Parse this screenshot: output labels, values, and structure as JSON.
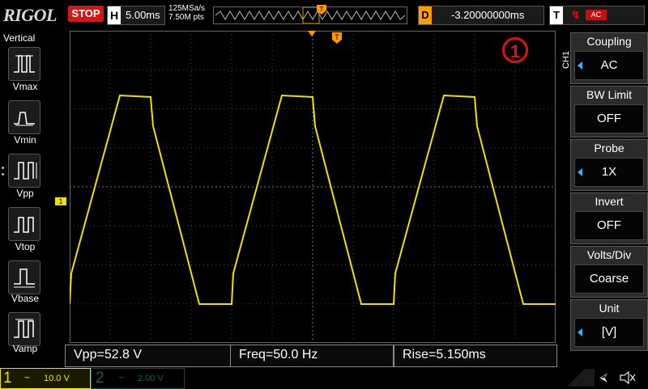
{
  "header": {
    "logo": "RIGOL",
    "run_state": "STOP",
    "horizontal_label": "H",
    "timebase": "5.00ms",
    "sample_rate": "125MSa/s",
    "memory_depth": "7.50M pts",
    "delay_label": "D",
    "delay_value": "-3.20000000ms",
    "trigger_label": "T",
    "trigger_slope_icon": "rising-edge-icon",
    "trigger_source": "AC"
  },
  "left_panel": {
    "title": "Vertical",
    "measures": [
      {
        "label": "Vmax",
        "icon": "vmax-icon"
      },
      {
        "label": "Vmin",
        "icon": "vmin-icon"
      },
      {
        "label": "Vpp",
        "icon": "vpp-icon"
      },
      {
        "label": "Vtop",
        "icon": "vtop-icon"
      },
      {
        "label": "Vbase",
        "icon": "vbase-icon"
      },
      {
        "label": "Vamp",
        "icon": "vamp-icon"
      }
    ]
  },
  "waveform": {
    "channel_marker": "1",
    "trigger_marker": "T",
    "color": "#f0e000",
    "badge": "1"
  },
  "right_menu": {
    "channel_tag": "CH1",
    "items": [
      {
        "title": "Coupling",
        "value": "AC",
        "arrow": true
      },
      {
        "title": "BW Limit",
        "value": "OFF",
        "arrow": false
      },
      {
        "title": "Probe",
        "value": "1X",
        "arrow": true
      },
      {
        "title": "Invert",
        "value": "OFF",
        "arrow": false
      },
      {
        "title": "Volts/Div",
        "value": "Coarse",
        "arrow": false
      },
      {
        "title": "Unit",
        "value": "[V]",
        "arrow": true
      }
    ]
  },
  "measurements": [
    {
      "text": "Vpp=52.8 V"
    },
    {
      "text": "Freq=50.0 Hz"
    },
    {
      "text": "Rise=5.150ms"
    }
  ],
  "status": {
    "ch1_num": "1",
    "ch1_coupling": "~",
    "ch1_scale": "10.0 V",
    "ch2_num": "2",
    "ch2_coupling": "~",
    "ch2_scale": "2.00 V"
  },
  "colors": {
    "ch1": "#f0e000",
    "stop": "#d01818",
    "delay": "#ff9a00",
    "menu_arrow": "#3ab0ff"
  }
}
